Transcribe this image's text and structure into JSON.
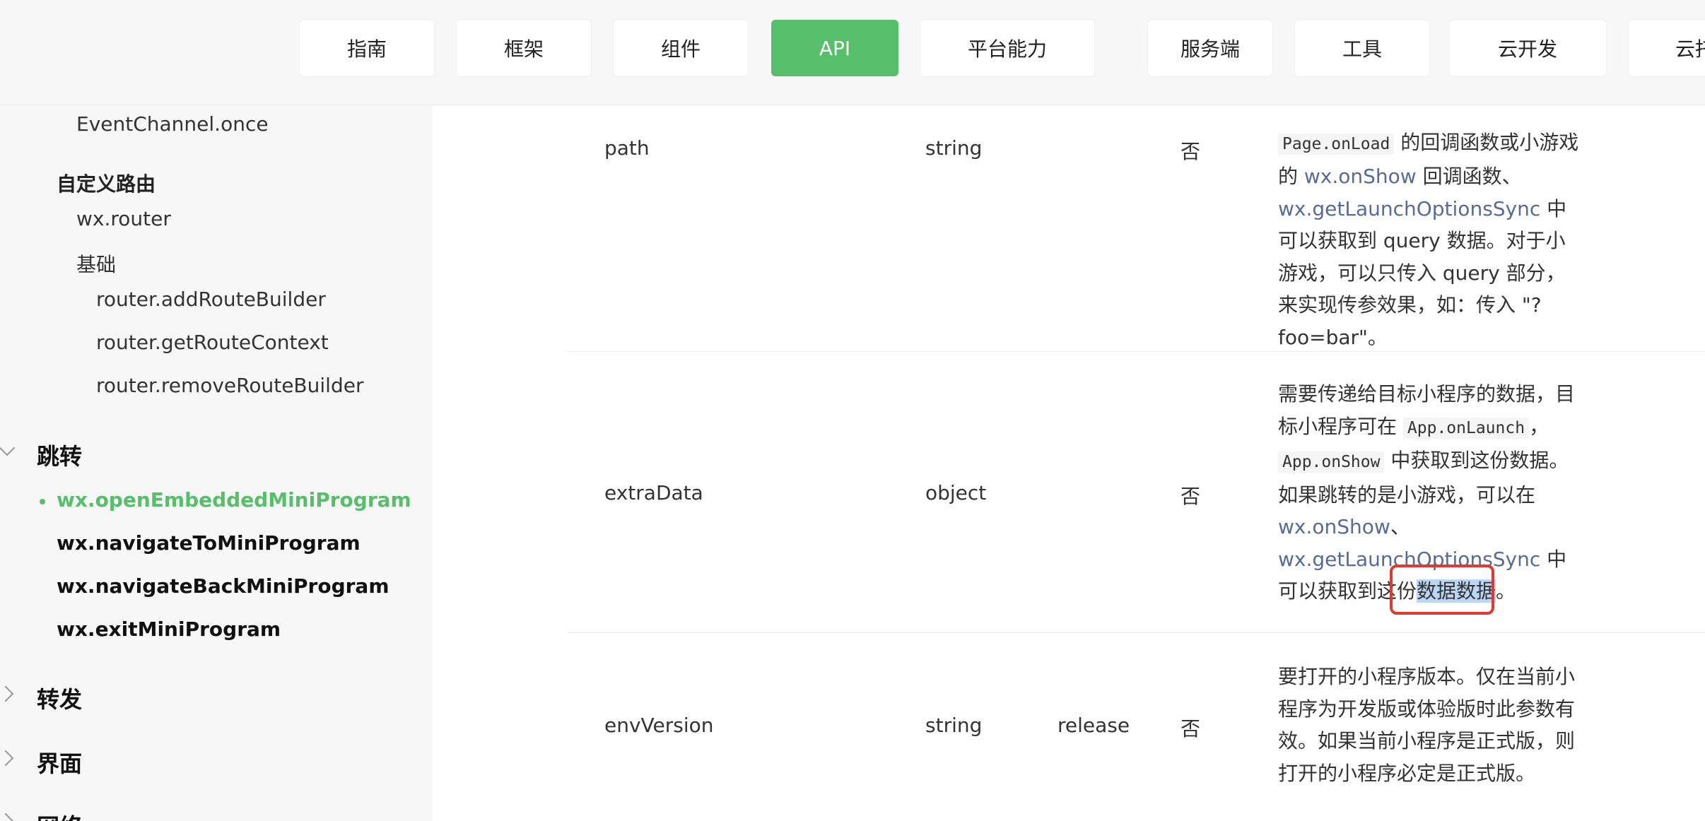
{
  "nav": {
    "tabs": [
      "指南",
      "框架",
      "组件",
      "API",
      "平台能力",
      "服务端",
      "工具",
      "云开发",
      "云托"
    ],
    "active": "API"
  },
  "sidebar": {
    "items": {
      "eventchannel_once": "EventChannel.once",
      "group_custom_router": "自定义路由",
      "wx_router": "wx.router",
      "sub_basic": "基础",
      "add_route_builder": "router.addRouteBuilder",
      "get_route_context": "router.getRouteContext",
      "remove_route_builder": "router.removeRouteBuilder",
      "section_jump": "跳转",
      "open_embedded": "wx.openEmbeddedMiniProgram",
      "navigate_to": "wx.navigateToMiniProgram",
      "navigate_back": "wx.navigateBackMiniProgram",
      "exit": "wx.exitMiniProgram",
      "section_forward": "转发",
      "section_ui": "界面",
      "section_network": "网络"
    }
  },
  "table": {
    "rows": [
      {
        "name": "path",
        "type": "string",
        "default": "",
        "required": "否",
        "desc": {
          "code1": "Page.onLoad",
          "t1": " 的回调函数或小游戏的 ",
          "link1": "wx.onShow",
          "t2": " 回调函数、",
          "link2": "wx.getLaunchOptionsSync",
          "t3": " 中可以获取到 query 数据。对于小游戏，可以只传入 query 部分，来实现传参效果，如：传入 \"?foo=bar\"。"
        }
      },
      {
        "name": "extraData",
        "type": "object",
        "default": "",
        "required": "否",
        "desc": {
          "t1": "需要传递给目标小程序的数据，目标小程序可在 ",
          "code1": "App.onLaunch",
          "t2": "，",
          "code2": "App.onShow",
          "t3": " 中获取到这份数据。如果跳转的是小游戏，可以在 ",
          "link1": "wx.onShow",
          "t4": "、",
          "link2": "wx.getLaunchOptionsSync",
          "t5": " 中可以获取到这份",
          "highlight": "数据数据",
          "t6": "。"
        }
      },
      {
        "name": "envVersion",
        "type": "string",
        "default": "release",
        "required": "否",
        "desc": {
          "t1": "要打开的小程序版本。仅在当前小程序为开发版或体验版时此参数有效。如果当前小程序是正式版，则打开的小程序必定是正式版。"
        }
      }
    ]
  },
  "colors": {
    "accent": "#57be6a",
    "link": "#576b95",
    "highlight": "#bcd6f6",
    "annotation": "#e2392f"
  }
}
